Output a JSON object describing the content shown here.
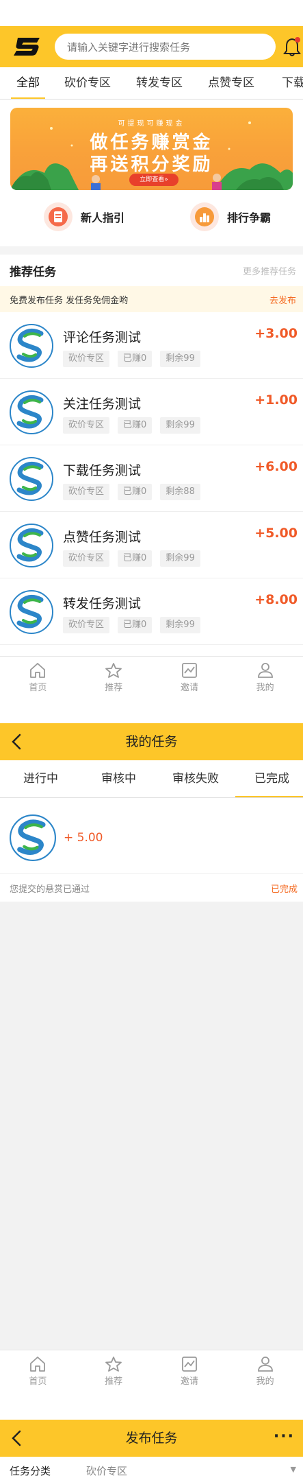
{
  "home": {
    "search": {
      "placeholder": "请输入关键字进行搜索任务"
    },
    "category_tabs": [
      "全部",
      "砍价专区",
      "转发专区",
      "点赞专区",
      "下载"
    ],
    "banner": {
      "small_text": "可提现可赚现金",
      "line1": "做任务赚赏金",
      "line2": "再送积分奖励",
      "button": "立即查看»"
    },
    "quick_links": [
      {
        "label": "新人指引",
        "icon": "guide-icon"
      },
      {
        "label": "排行争霸",
        "icon": "ranking-icon"
      }
    ],
    "recommend": {
      "title": "推荐任务",
      "more": "更多推荐任务"
    },
    "notice": {
      "text": "免费发布任务 发任务免佣金哟",
      "action": "去发布"
    },
    "tasks": [
      {
        "name": "评论任务测试",
        "reward": "+3.00",
        "tags": [
          "砍价专区",
          "已赚0",
          "剩余99"
        ]
      },
      {
        "name": "关注任务测试",
        "reward": "+1.00",
        "tags": [
          "砍价专区",
          "已赚0",
          "剩余99"
        ]
      },
      {
        "name": "下载任务测试",
        "reward": "+6.00",
        "tags": [
          "砍价专区",
          "已赚0",
          "剩余88"
        ]
      },
      {
        "name": "点赞任务测试",
        "reward": "+5.00",
        "tags": [
          "砍价专区",
          "已赚0",
          "剩余99"
        ]
      },
      {
        "name": "转发任务测试",
        "reward": "+8.00",
        "tags": [
          "砍价专区",
          "已赚0",
          "剩余99"
        ]
      }
    ]
  },
  "tabbar": [
    "首页",
    "推荐",
    "邀请",
    "我的"
  ],
  "my_tasks": {
    "title": "我的任务",
    "tabs": [
      "进行中",
      "审核中",
      "审核失败",
      "已完成"
    ],
    "active_tab": "已完成",
    "item": {
      "reward": "+ 5.00",
      "status_text": "您提交的悬赏已通过",
      "status": "已完成"
    }
  },
  "publish": {
    "title": "发布任务",
    "more": "···",
    "category_label": "任务分类",
    "category_value": "砍价专区",
    "dropdown_arrow": "▼"
  },
  "colors": {
    "brand_yellow": "#fdc629",
    "reward_red": "#f05a28",
    "accent_orange": "#f46a21"
  }
}
